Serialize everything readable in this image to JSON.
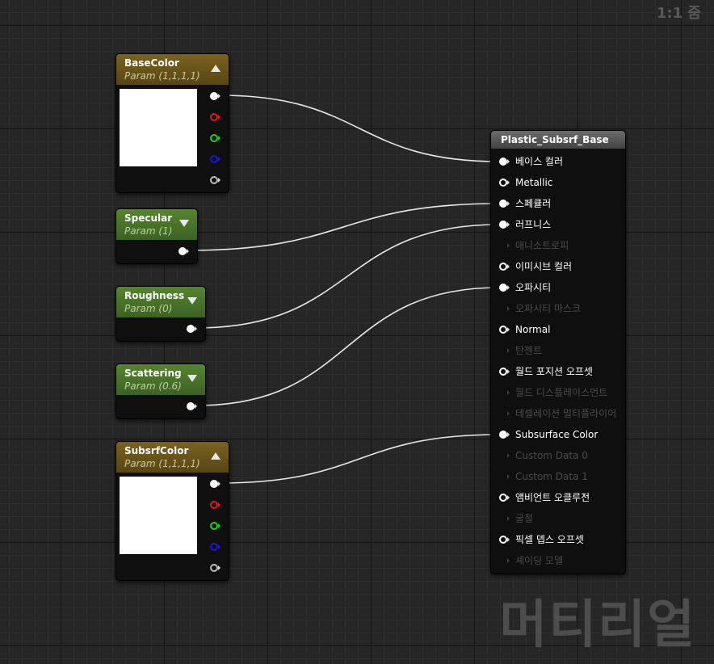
{
  "zoom_label": "1:1 줌",
  "watermark": "머티리얼",
  "nodes": {
    "basecolor": {
      "title": "BaseColor",
      "subtitle": "Param (1,1,1,1)"
    },
    "specular": {
      "title": "Specular",
      "subtitle": "Param (1)"
    },
    "roughness": {
      "title": "Roughness",
      "subtitle": "Param (0)"
    },
    "scattering": {
      "title": "Scattering",
      "subtitle": "Param (0.6)"
    },
    "subsrfcolor": {
      "title": "SubsrfColor",
      "subtitle": "Param (1,1,1,1)"
    }
  },
  "material": {
    "title": "Plastic_Subsrf_Base",
    "inputs": [
      {
        "label": "베이스 컬러",
        "state": "connected"
      },
      {
        "label": "Metallic",
        "state": "enabled"
      },
      {
        "label": "스페큘러",
        "state": "connected"
      },
      {
        "label": "러프니스",
        "state": "connected"
      },
      {
        "label": "애니소트로피",
        "state": "disabled"
      },
      {
        "label": "이미시브 컬러",
        "state": "enabled"
      },
      {
        "label": "오파시티",
        "state": "connected"
      },
      {
        "label": "오파시티 마스크",
        "state": "disabled"
      },
      {
        "label": "Normal",
        "state": "enabled"
      },
      {
        "label": "탄젠트",
        "state": "disabled"
      },
      {
        "label": "월드 포지션 오프셋",
        "state": "enabled"
      },
      {
        "label": "월드 디스플레이스먼트",
        "state": "disabled"
      },
      {
        "label": "테셀레이션 멀티플라이어",
        "state": "disabled"
      },
      {
        "label": "Subsurface Color",
        "state": "connected"
      },
      {
        "label": "Custom Data 0",
        "state": "disabled"
      },
      {
        "label": "Custom Data 1",
        "state": "disabled"
      },
      {
        "label": "앰비언트 오클루전",
        "state": "enabled"
      },
      {
        "label": "굴절",
        "state": "disabled"
      },
      {
        "label": "픽셀 뎁스 오프셋",
        "state": "enabled"
      },
      {
        "label": "셰이딩 모델",
        "state": "disabled"
      }
    ]
  },
  "colors": {
    "vector_param_header": "#6e5a1d",
    "scalar_param_header": "#4f7a2c",
    "material_header": "#5a5a5a",
    "pin_r": "#e01818",
    "pin_g": "#19d319",
    "pin_b": "#1818dd",
    "wire": "#e8e8e8"
  }
}
